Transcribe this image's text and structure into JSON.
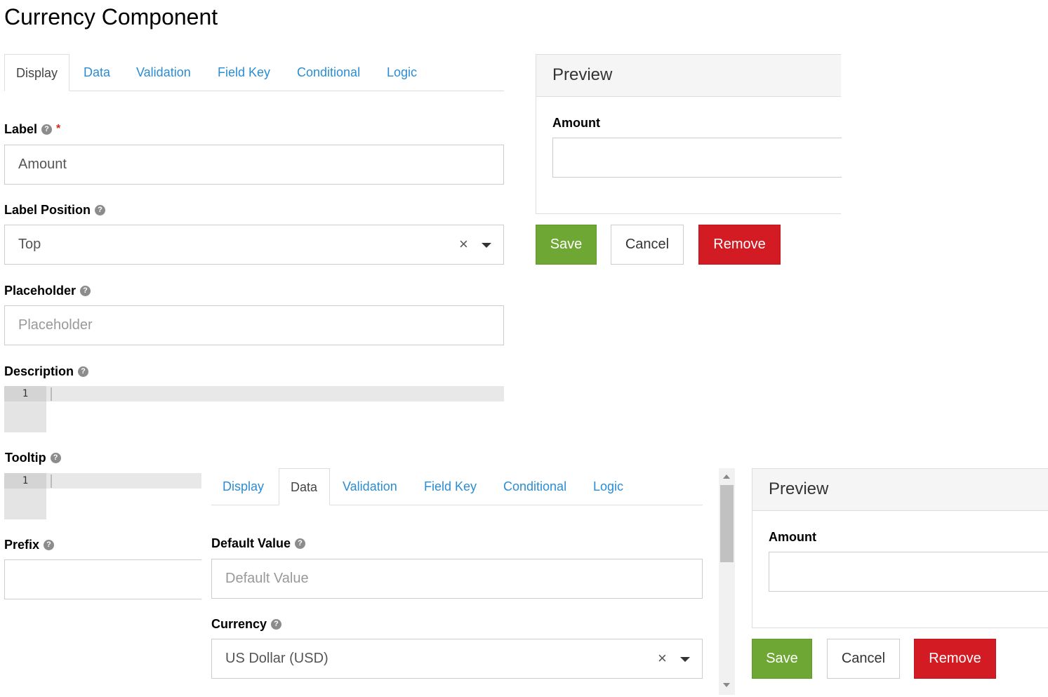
{
  "title": "Currency Component",
  "tabs": [
    "Display",
    "Data",
    "Validation",
    "Field Key",
    "Conditional",
    "Logic"
  ],
  "display": {
    "label_label": "Label",
    "label_value": "Amount",
    "label_position_label": "Label Position",
    "label_position_value": "Top",
    "placeholder_label": "Placeholder",
    "placeholder_placeholder": "Placeholder",
    "description_label": "Description",
    "tooltip_label": "Tooltip",
    "prefix_label": "Prefix",
    "line_number": "1"
  },
  "data_tab": {
    "default_value_label": "Default Value",
    "default_value_placeholder": "Default Value",
    "currency_label": "Currency",
    "currency_value": "US Dollar (USD)"
  },
  "preview": {
    "heading": "Preview",
    "field_label": "Amount"
  },
  "buttons": {
    "save": "Save",
    "cancel": "Cancel",
    "remove": "Remove"
  },
  "icons": {
    "help": "question-circle-icon",
    "clear": "close-icon",
    "dropdown": "caret-down-icon"
  },
  "colors": {
    "link": "#2a8dd4",
    "save": "#6ea733",
    "remove": "#d31b23",
    "required": "#d9261c"
  }
}
